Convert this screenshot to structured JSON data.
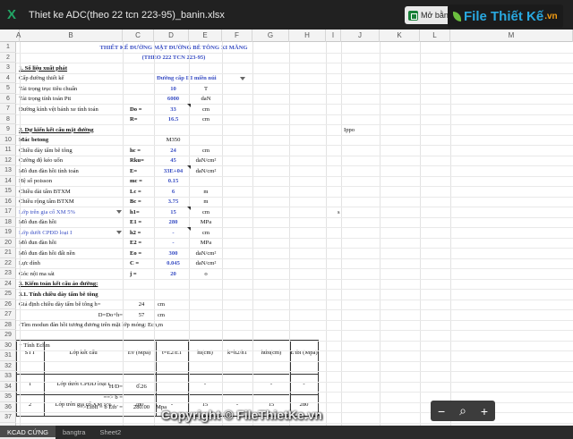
{
  "app": {
    "icon": "excel-x-icon",
    "icon_glyph": "X",
    "title": "Thiet ke ADC(theo 22 tcn 223-95)_banin.xlsx",
    "open_button": "Mở bằng",
    "open_icon": "google-sheets-icon"
  },
  "watermark": {
    "logo": "File Thiết Kế",
    "logo_domain": ".vn",
    "copyright": "Copyright © FileThietKe.vn"
  },
  "columns": [
    "A",
    "B",
    "C",
    "D",
    "E",
    "F",
    "G",
    "H",
    "I",
    "J",
    "K",
    "L",
    "M"
  ],
  "rows": [
    "1",
    "2",
    "3",
    "4",
    "5",
    "6",
    "7",
    "8",
    "9",
    "10",
    "11",
    "12",
    "13",
    "14",
    "15",
    "16",
    "17",
    "18",
    "19",
    "20",
    "21",
    "22",
    "23",
    "24",
    "25",
    "26",
    "27",
    "28",
    "29",
    "30",
    "31",
    "32",
    "33",
    "34",
    "35",
    "36",
    "37"
  ],
  "sheet": {
    "title1": "THIẾT KẾ ĐƯỜNG MẶT ĐƯỜNG BÊ TÔNG XI MĂNG",
    "title2": "(THEO 222 TCN 223-95)",
    "s1": "1. Số liệu xuất phát",
    "r4": {
      "a": "Cấp đường thiết kế",
      "d": "Đường cấp III miền núi"
    },
    "r5": {
      "a": "Tải trọng trục tiêu chuẩn",
      "d": "10",
      "e": "T"
    },
    "r6": {
      "a": "Tải trọng tính toán Ptt",
      "d": "6000",
      "e": "daN"
    },
    "r7": {
      "a": "Đường kính vệt bánh xe tính toán",
      "c": "Do =",
      "d": "33",
      "e": "cm"
    },
    "r8": {
      "c": "R=",
      "d": "16.5",
      "e": "cm"
    },
    "s2": "2. Dự kiến kết cấu mặt đường",
    "j9": "Ippo",
    "r10": {
      "a": "Mác betong",
      "d": "M350"
    },
    "r11": {
      "a": "Chiều dày tấm bê tông",
      "c": "hc =",
      "d": "24",
      "e": "cm"
    },
    "r12": {
      "a": "Cường độ kéo uốn",
      "c": "Rku=",
      "d": "45",
      "e": "daN/cm²"
    },
    "r13": {
      "a": "Mô đun đàn hồi tính toán",
      "c": "E=",
      "d": "33E+04",
      "e": "daN/cm²"
    },
    "r14": {
      "a": "Hệ số poisson",
      "c": "mc =",
      "d": "0.15"
    },
    "r15": {
      "a": "Chiều dài tấm BTXM",
      "c": "Lc =",
      "d": "6",
      "e": "m"
    },
    "r16": {
      "a": "Chiều rộng tấm BTXM",
      "c": "Bc =",
      "d": "3.75",
      "e": "m"
    },
    "r17": {
      "a": "Lớp trên gia cố XM 5%",
      "c": "h1=",
      "d": "15",
      "e": "cm",
      "j": "s"
    },
    "r18": {
      "a": "Mô đun đàn hồi",
      "c": "E1 =",
      "d": "280",
      "e": "MPa"
    },
    "r19": {
      "a": "Lớp dưới CPĐD loại I",
      "c": "h2 =",
      "d": "-",
      "e": "cm"
    },
    "r20": {
      "a": "Mô đun đàn hồi",
      "c": "E2 =",
      "d": "-",
      "e": "MPa"
    },
    "r21": {
      "a": "Mô đun đàn hồi đất nền",
      "c": "Eo =",
      "d": "300",
      "e": "daN/cm²"
    },
    "r22": {
      "a": "Lực dính",
      "c": "C =",
      "d": "0.045",
      "e": "daN/cm²"
    },
    "r23": {
      "a": "Góc nội ma sát",
      "c": "j =",
      "d": "20",
      "e": "o"
    },
    "s3": "3. Kiểm toán kết cấu áo đường:",
    "s31": "3.1. Tính chiều dày tấm bê tông",
    "r26": {
      "a": "Giả định chiều dày tấm bê tông h=",
      "c": "24",
      "d": "cm"
    },
    "r27": {
      "b": "D=Do+h=",
      "c": "57",
      "d": "cm"
    },
    "r28": "-Tìm modun đàn hồi tương đương trên mặt lớp móng: Ech,m",
    "r30": "+ Tính Echm",
    "table": {
      "headers": [
        "STT",
        "Lớp kết cấu",
        "Ev (Mpa)",
        "t=E2/E1",
        "hi(cm)",
        "k=h2/h1",
        "htbi(cm)",
        "E'tbi (Mpa)"
      ],
      "rows": [
        [
          "1",
          "Lớp dưới CPĐD loại I",
          "-",
          "",
          "-",
          "",
          "-",
          "-"
        ],
        [
          "2",
          "Lớp trên gia cố XM 5%",
          "280",
          "-",
          "15",
          "-",
          "15",
          "280"
        ]
      ]
    },
    "r34": {
      "b": "H/D=",
      "c": "0.26"
    },
    "r35": {
      "b": "==> b ="
    },
    "r36": {
      "b": "=>Etbtt = b Etb' =",
      "c": "280.00",
      "d": "Mpa"
    }
  },
  "tabs": [
    "KCAD CỨNG",
    "bangtra",
    "Sheet2"
  ],
  "zoom": {
    "minus": "−",
    "search": "⌕",
    "plus": "+"
  }
}
